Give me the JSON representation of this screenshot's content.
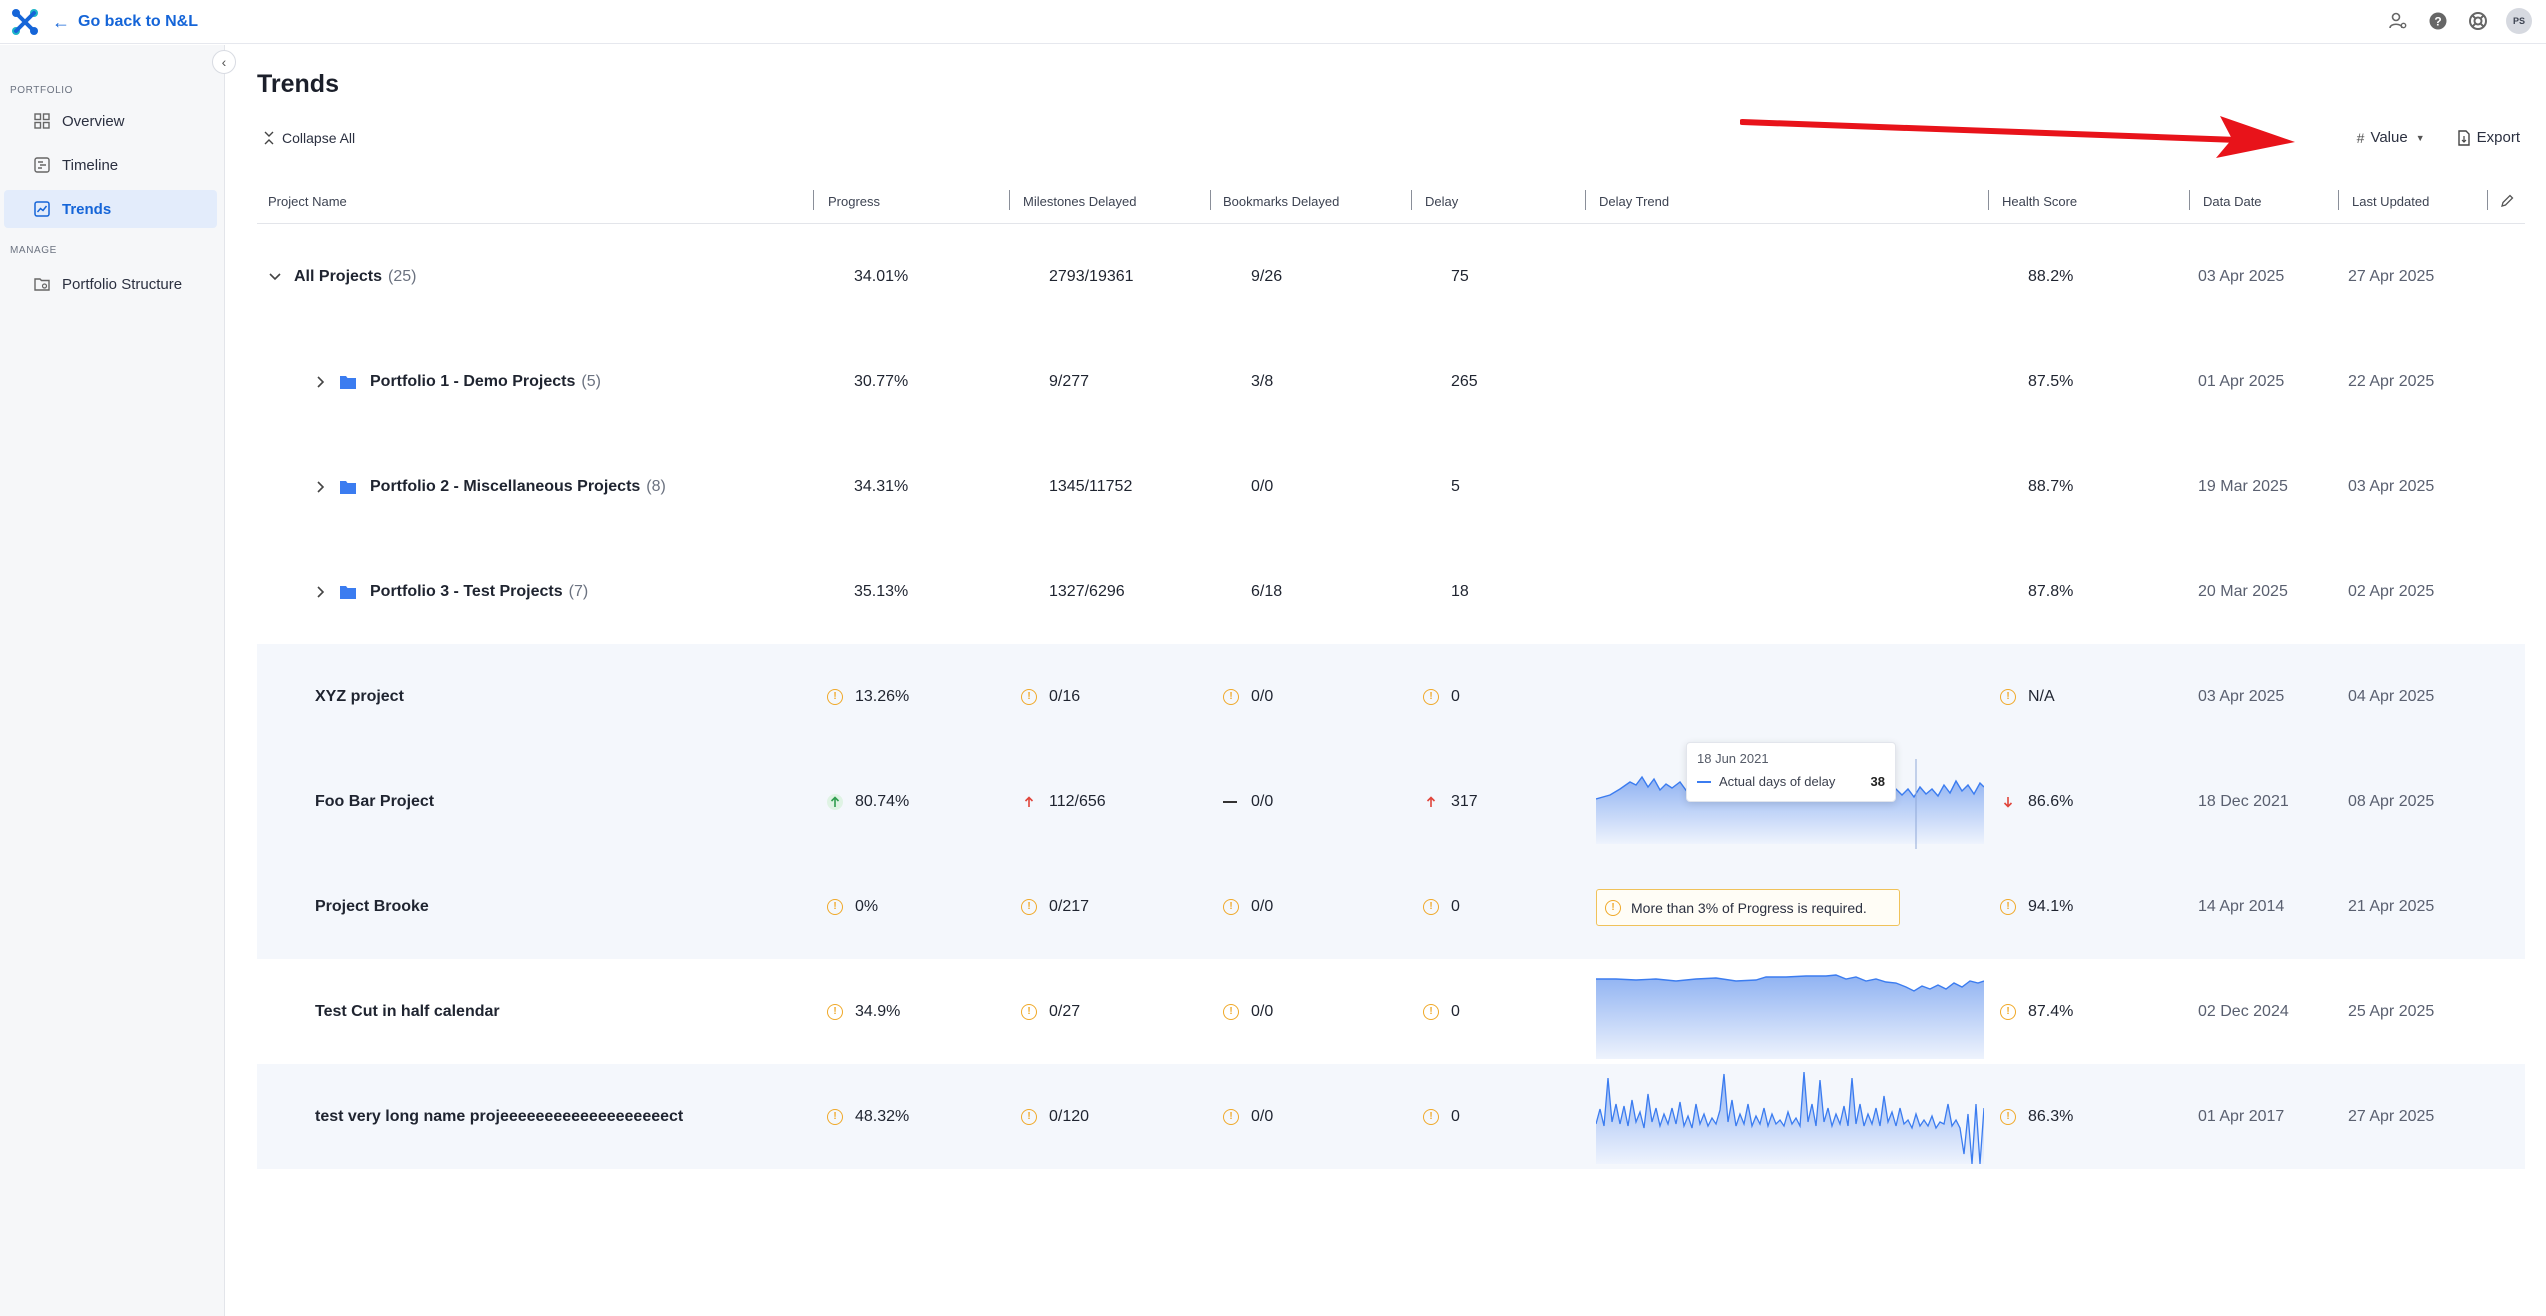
{
  "topbar": {
    "back_label": "Go back to N&L",
    "avatar_initials": "PS"
  },
  "sidebar": {
    "portfolio_section": "PORTFOLIO",
    "manage_section": "MANAGE",
    "items": [
      {
        "label": "Overview",
        "icon": "grid-icon"
      },
      {
        "label": "Timeline",
        "icon": "timeline-icon"
      },
      {
        "label": "Trends",
        "icon": "trend-chart-icon",
        "active": true
      },
      {
        "label": "Portfolio Structure",
        "icon": "folder-settings-icon"
      }
    ]
  },
  "main": {
    "title": "Trends",
    "collapse_all": "Collapse All",
    "value_label": "Value",
    "export_label": "Export"
  },
  "table": {
    "columns": [
      "Project Name",
      "Progress",
      "Milestones Delayed",
      "Bookmarks Delayed",
      "Delay",
      "Delay Trend",
      "Health Score",
      "Data Date",
      "Last Updated"
    ],
    "rows": [
      {
        "name": "All Projects",
        "count": "(25)",
        "progress": "34.01%",
        "milestones": "2793/19361",
        "bookmarks": "9/26",
        "delay": "75",
        "health": "88.2%",
        "data_date": "03 Apr 2025",
        "last_updated": "27 Apr 2025"
      },
      {
        "name": "Portfolio 1 - Demo Projects",
        "count": "(5)",
        "progress": "30.77%",
        "milestones": "9/277",
        "bookmarks": "3/8",
        "delay": "265",
        "health": "87.5%",
        "data_date": "01 Apr 2025",
        "last_updated": "22 Apr 2025"
      },
      {
        "name": "Portfolio 2 - Miscellaneous Projects",
        "count": "(8)",
        "progress": "34.31%",
        "milestones": "1345/11752",
        "bookmarks": "0/0",
        "delay": "5",
        "health": "88.7%",
        "data_date": "19 Mar 2025",
        "last_updated": "03 Apr 2025"
      },
      {
        "name": "Portfolio 3 - Test Projects",
        "count": "(7)",
        "progress": "35.13%",
        "milestones": "1327/6296",
        "bookmarks": "6/18",
        "delay": "18",
        "health": "87.8%",
        "data_date": "20 Mar 2025",
        "last_updated": "02 Apr 2025"
      },
      {
        "name": "XYZ project",
        "progress": "13.26%",
        "milestones": "0/16",
        "bookmarks": "0/0",
        "delay": "0",
        "health": "N/A",
        "data_date": "03 Apr 2025",
        "last_updated": "04 Apr 2025"
      },
      {
        "name": "Foo Bar Project",
        "progress": "80.74%",
        "milestones": "112/656",
        "bookmarks": "0/0",
        "delay": "317",
        "health": "86.6%",
        "data_date": "18 Dec 2021",
        "last_updated": "08 Apr 2025"
      },
      {
        "name": "Project Brooke",
        "progress": "0%",
        "milestones": "0/217",
        "bookmarks": "0/0",
        "delay": "0",
        "health": "94.1%",
        "data_date": "14 Apr 2014",
        "last_updated": "21 Apr 2025"
      },
      {
        "name": "Test Cut in half calendar",
        "progress": "34.9%",
        "milestones": "0/27",
        "bookmarks": "0/0",
        "delay": "0",
        "health": "87.4%",
        "data_date": "02 Dec 2024",
        "last_updated": "25 Apr 2025"
      },
      {
        "name": "test very long name projeeeeeeeeeeeeeeeeeeect",
        "progress": "48.32%",
        "milestones": "0/120",
        "bookmarks": "0/0",
        "delay": "0",
        "health": "86.3%",
        "data_date": "01 Apr 2017",
        "last_updated": "27 Apr 2025"
      }
    ]
  },
  "tooltip": {
    "date": "18 Jun 2021",
    "series": "Actual days of delay",
    "value": "38"
  },
  "warning": {
    "text": "More than 3% of Progress is required."
  },
  "colors": {
    "accent": "#1565d8",
    "warn": "#f0a92a",
    "up_red": "#e0443a",
    "up_green": "#2f9e4f",
    "spark": "#3b7cf0",
    "annotation": "#e8131a"
  }
}
